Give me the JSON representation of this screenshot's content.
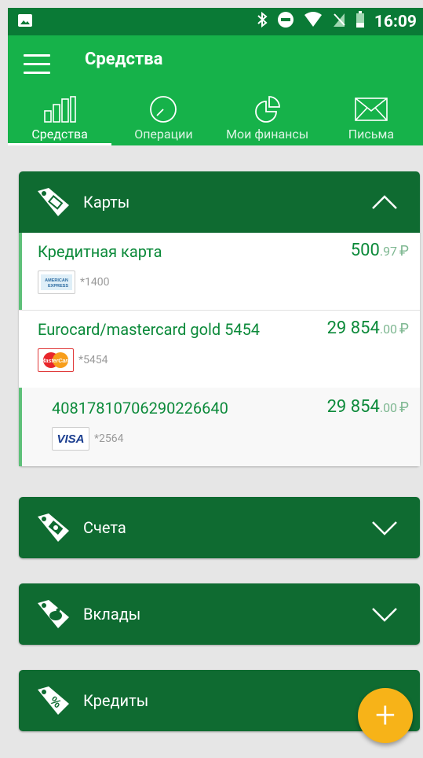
{
  "status_bar": {
    "time": "16:09"
  },
  "app_bar": {
    "title": "Средства"
  },
  "tabs": [
    {
      "label": "Средства",
      "icon": "bar-chart-icon",
      "active": true
    },
    {
      "label": "Операции",
      "icon": "clock-icon",
      "active": false
    },
    {
      "label": "Мои финансы",
      "icon": "pie-chart-icon",
      "active": false
    },
    {
      "label": "Письма",
      "icon": "envelope-icon",
      "active": false
    }
  ],
  "sections": {
    "cards": {
      "label": "Карты",
      "expanded": true
    },
    "accounts": {
      "label": "Счета",
      "expanded": false
    },
    "deposits": {
      "label": "Вклады",
      "expanded": false
    },
    "credits": {
      "label": "Кредиты",
      "expanded": false
    }
  },
  "card_rows": [
    {
      "name": "Кредитная карта",
      "amount_main": "500",
      "amount_cents": ".97",
      "currency": "₽",
      "logo": "AMERICAN EXPRESS",
      "mask": "*1400"
    },
    {
      "name": "Eurocard/mastercard gold 5454",
      "amount_main": "29 854",
      "amount_cents": ".00",
      "currency": "₽",
      "logo": "MasterCard",
      "mask": "*5454"
    },
    {
      "name": "40817810706290226640",
      "amount_main": "29 854",
      "amount_cents": ".00",
      "currency": "₽",
      "logo": "VISA",
      "mask": "*2564"
    }
  ],
  "fab": {
    "label": "+"
  },
  "colors": {
    "primary": "#16b24a",
    "dark": "#0f6b31",
    "accent": "#f7b318"
  }
}
